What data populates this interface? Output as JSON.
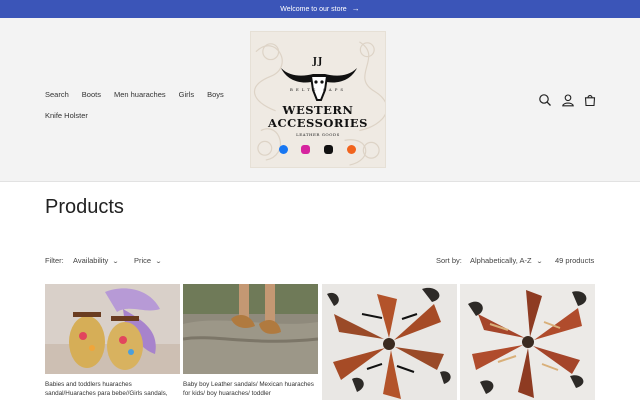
{
  "announcement": {
    "text": "Welcome to our store",
    "arrow_icon": "arrow-right-icon"
  },
  "nav": {
    "row1": [
      "Search",
      "Boots",
      "Men huaraches",
      "Girls",
      "Boys"
    ],
    "row2": [
      "Knife Holster"
    ]
  },
  "logo": {
    "jj": "JJ",
    "belts_caps": "BELTS  CAPS",
    "line1": "WESTERN",
    "line2": "ACCESSORIES",
    "leather": "LEATHER GOODS",
    "social_icons": [
      "facebook-icon",
      "instagram-icon",
      "tiktok-icon",
      "etsy-icon"
    ]
  },
  "header_icons": [
    "search-icon",
    "account-icon",
    "cart-icon"
  ],
  "page": {
    "title": "Products"
  },
  "filters": {
    "label": "Filter:",
    "availability": "Availability",
    "price": "Price",
    "sort_label": "Sort by:",
    "sort_value": "Alphabetically, A-Z",
    "count": "49 products"
  },
  "products": [
    {
      "title": "Babies and toddlers huaraches sandal/Huaraches para bebe//Girls sandals,"
    },
    {
      "title": "Baby boy Leather sandals/ Mexican huaraches for kids/ boy huaraches/ toddler"
    },
    {
      "title": ""
    },
    {
      "title": ""
    }
  ],
  "colors": {
    "announcement_bg": "#3b55b8",
    "header_bg": "#f3f3f3"
  }
}
